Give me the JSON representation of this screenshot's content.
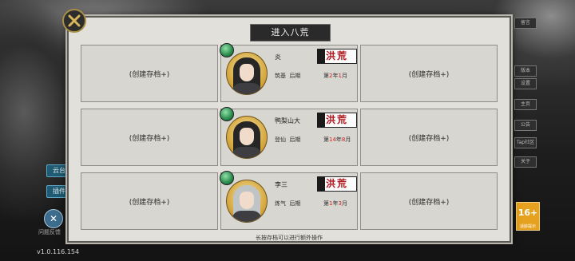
{
  "panel": {
    "title": "进入八荒",
    "hint": "长按存档可以进行额外操作",
    "empty_slot_label": "(创建存档+)"
  },
  "rows": [
    {
      "left": "(创建存档+)",
      "right": "(创建存档+)",
      "character": {
        "name": "炎",
        "realm": "筑基",
        "stage": "后期",
        "date_prefix": "第",
        "year": "2",
        "year_suffix": "年",
        "month": "1",
        "month_suffix": "月",
        "mode": "洪荒",
        "hair": "black"
      }
    },
    {
      "left": "(创建存档+)",
      "right": "(创建存档+)",
      "character": {
        "name": "鸭梨山大",
        "realm": "登仙",
        "stage": "后期",
        "date_prefix": "第",
        "year": "14",
        "year_suffix": "年",
        "month": "8",
        "month_suffix": "月",
        "mode": "洪荒",
        "hair": "black"
      }
    },
    {
      "left": "(创建存档+)",
      "right": "(创建存档+)",
      "character": {
        "name": "李三",
        "realm": "炼气",
        "stage": "后期",
        "date_prefix": "第",
        "year": "1",
        "year_suffix": "年",
        "month": "3",
        "month_suffix": "月",
        "mode": "洪荒",
        "hair": "gray"
      }
    }
  ],
  "background": {
    "version": "v1.0.116.154",
    "left_tags": [
      "云台",
      "插件"
    ],
    "left_round_label": "问题反馈",
    "right_tabs": [
      "留言",
      "版本",
      "设置",
      "主页",
      "公告",
      "设置",
      "设置",
      "Tap社区",
      "关于"
    ],
    "age_badge": "16+",
    "age_badge_sub": "适龄提示"
  },
  "colors": {
    "panel_bg": "#e2e0da",
    "title_bg": "#2a2a2a",
    "mode_red": "#b0121b",
    "date_red": "#cf1f1f",
    "close_gold": "#a88f45"
  },
  "icons": {
    "close": "close-x-icon",
    "gem": "jade-gem-icon",
    "portrait": "character-portrait"
  }
}
